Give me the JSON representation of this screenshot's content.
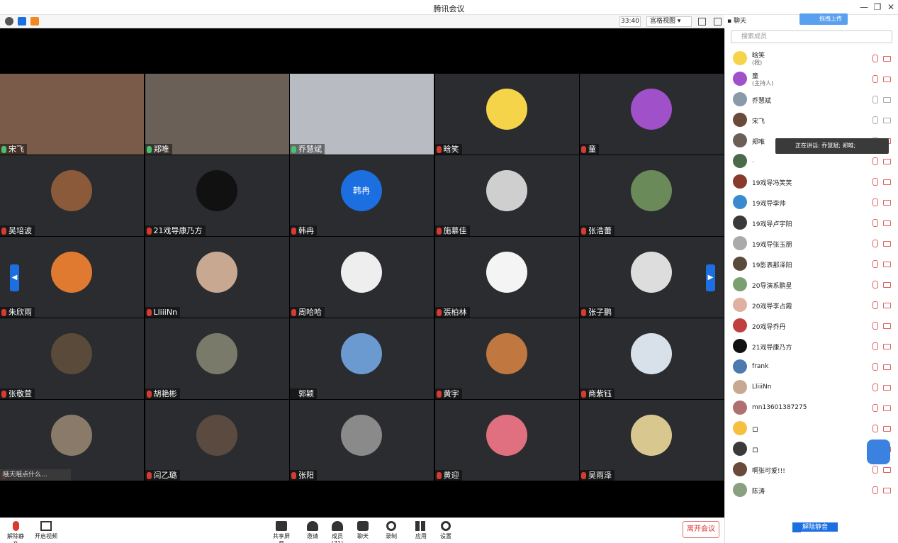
{
  "window": {
    "title": "腾讯会议"
  },
  "toolbar": {
    "timer": "33:40",
    "view_label": "宫格视图",
    "chat_label": "聊天"
  },
  "upload_label": "拖拽上传",
  "participants": [
    {
      "name": "宋飞",
      "mic": "on",
      "video": true,
      "color": "#7a5b4a"
    },
    {
      "name": "郑唯",
      "mic": "on",
      "video": true,
      "color": "#6a6058"
    },
    {
      "name": "乔慧斌",
      "mic": "on",
      "video": true,
      "color": "#b8bcc2"
    },
    {
      "name": "晗笑",
      "mic": "off",
      "video": false,
      "color": "#f5d44a"
    },
    {
      "name": "童",
      "mic": "off",
      "video": false,
      "color": "#a050c8"
    },
    {
      "name": "吴培波",
      "mic": "off",
      "video": false,
      "color": "#8a5a3a"
    },
    {
      "name": "21戏导康乃方",
      "mic": "off",
      "video": false,
      "color": "#111111"
    },
    {
      "name": "韩冉",
      "mic": "off",
      "video": false,
      "color": "#1c6fe0",
      "avatar_text": "韩冉"
    },
    {
      "name": "施慕佳",
      "mic": "off",
      "video": false,
      "color": "#cfcfcf"
    },
    {
      "name": "张浩蕾",
      "mic": "off",
      "video": false,
      "color": "#6a8a5a"
    },
    {
      "name": "朱欣雨",
      "mic": "off",
      "video": false,
      "color": "#e07a30"
    },
    {
      "name": "LliiiNn",
      "mic": "off",
      "video": false,
      "color": "#c8a890"
    },
    {
      "name": "周哈哈",
      "mic": "off",
      "video": false,
      "color": "#eeeeee"
    },
    {
      "name": "張柏林",
      "mic": "off",
      "video": false,
      "color": "#f4f4f4"
    },
    {
      "name": "张子鹏",
      "mic": "off",
      "video": false,
      "color": "#dddddd"
    },
    {
      "name": "张敬萱",
      "mic": "off",
      "video": false,
      "color": "#5a4a3a"
    },
    {
      "name": "胡艳彬",
      "mic": "off",
      "video": false,
      "color": "#7a7a6a"
    },
    {
      "name": "郭颖",
      "mic": "none",
      "video": false,
      "color": "#6a9ad0"
    },
    {
      "name": "黄宇",
      "mic": "off",
      "video": false,
      "color": "#c07840"
    },
    {
      "name": "商紫钰",
      "mic": "off",
      "video": false,
      "color": "#d8e0ea"
    },
    {
      "name": "",
      "mic": "off",
      "video": false,
      "color": "#8a7a6a"
    },
    {
      "name": "闫乙璐",
      "mic": "off",
      "video": false,
      "color": "#5a4a40"
    },
    {
      "name": "张阳",
      "mic": "off",
      "video": false,
      "color": "#8a8a8a"
    },
    {
      "name": "黄迎",
      "mic": "off",
      "video": false,
      "color": "#e07080"
    },
    {
      "name": "吴雨泽",
      "mic": "off",
      "video": false,
      "color": "#d8c890"
    }
  ],
  "speaking_text": "哦天哦点什么...",
  "bottombar": {
    "unmute": "解除静音",
    "start_video": "开启视频",
    "share": "共享屏幕",
    "invite": "邀请",
    "members": "成员(71)",
    "chat": "聊天",
    "record": "录制",
    "apps": "应用",
    "settings": "设置",
    "leave": "离开会议"
  },
  "sidebar": {
    "search_placeholder": "搜索成员",
    "tooltip": "正在讲话: 乔慧斌; 郑唯;",
    "unmute_all": "解除静音",
    "members": [
      {
        "name": "晗笑",
        "sub": "(我)",
        "color": "#f5d44a",
        "mic": "off"
      },
      {
        "name": "童",
        "sub": "(主持人)",
        "color": "#a050c8",
        "mic": "off"
      },
      {
        "name": "乔慧斌",
        "sub": "",
        "color": "#8a9aa8",
        "mic": "on"
      },
      {
        "name": "宋飞",
        "sub": "",
        "color": "#6a4a3a",
        "mic": "on"
      },
      {
        "name": "郑唯",
        "sub": "",
        "color": "#6a6058",
        "mic": "on"
      },
      {
        "name": ".",
        "sub": "",
        "color": "#4a6a4a",
        "mic": "off"
      },
      {
        "name": "19戏导冯笑笑",
        "sub": "",
        "color": "#8a3a2a",
        "mic": "off"
      },
      {
        "name": "19戏导李帅",
        "sub": "",
        "color": "#3a8ad0",
        "mic": "off"
      },
      {
        "name": "19戏导卢宇阳",
        "sub": "",
        "color": "#3a3a3a",
        "mic": "off"
      },
      {
        "name": "19戏导张玉朋",
        "sub": "",
        "color": "#aaaaaa",
        "mic": "off"
      },
      {
        "name": "19影表那泽阳",
        "sub": "",
        "color": "#5a4a3a",
        "mic": "off"
      },
      {
        "name": "20导演系鹏星",
        "sub": "",
        "color": "#7aa070",
        "mic": "off"
      },
      {
        "name": "20戏导李占霞",
        "sub": "",
        "color": "#e0b0a0",
        "mic": "off"
      },
      {
        "name": "20戏导乔丹",
        "sub": "",
        "color": "#c04040",
        "mic": "off"
      },
      {
        "name": "21戏导康乃方",
        "sub": "",
        "color": "#111111",
        "mic": "off"
      },
      {
        "name": "frank",
        "sub": "",
        "color": "#4a7ab0",
        "mic": "off"
      },
      {
        "name": "LliiiNn",
        "sub": "",
        "color": "#c8a890",
        "mic": "off"
      },
      {
        "name": "mn13601387275",
        "sub": "",
        "color": "#b07070",
        "mic": "off"
      },
      {
        "name": "ロ",
        "sub": "",
        "color": "#f5c040",
        "mic": "off"
      },
      {
        "name": "ロ",
        "sub": "",
        "color": "#3a3a3a",
        "mic": "off"
      },
      {
        "name": "啊张可爱!!!",
        "sub": "",
        "color": "#6a4a3a",
        "mic": "off"
      },
      {
        "name": "陈涛",
        "sub": "",
        "color": "#8aa080",
        "mic": "off"
      }
    ]
  }
}
